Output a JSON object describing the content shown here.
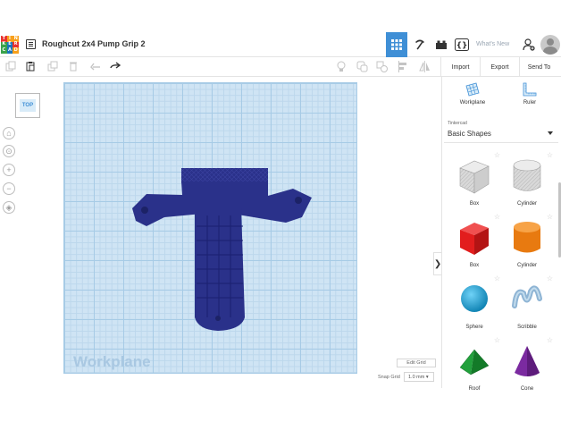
{
  "app": {
    "logo_letters": [
      "T",
      "I",
      "N",
      "K",
      "E",
      "R",
      "C",
      "A",
      "D"
    ],
    "logo_colors": [
      "#e8322f",
      "#f8a01c",
      "#f8a01c",
      "#3aa24a",
      "#1b75bb",
      "#e8322f",
      "#3aa24a",
      "#1b75bb",
      "#f8a01c"
    ],
    "design_title": "Roughcut 2x4 Pump Grip 2",
    "whats_new": "What's New"
  },
  "toolbar": {
    "import_label": "Import",
    "export_label": "Export",
    "send_to_label": "Send To"
  },
  "view": {
    "viewcube_face": "TOP"
  },
  "workplane": {
    "label": "Workplane",
    "edit_grid_label": "Edit Grid",
    "snap_grid_label": "Snap Grid",
    "snap_grid_value": "1.0 mm ▾"
  },
  "right_panel": {
    "workplane_tool": "Workplane",
    "ruler_tool": "Ruler",
    "library_owner": "Tinkercad",
    "library_name": "Basic Shapes",
    "shapes": [
      {
        "label": "Box",
        "icon": "box-hole-icon"
      },
      {
        "label": "Cylinder",
        "icon": "cylinder-hole-icon"
      },
      {
        "label": "Box",
        "icon": "box-red-icon"
      },
      {
        "label": "Cylinder",
        "icon": "cylinder-orange-icon"
      },
      {
        "label": "Sphere",
        "icon": "sphere-icon"
      },
      {
        "label": "Scribble",
        "icon": "scribble-icon"
      },
      {
        "label": "Roof",
        "icon": "roof-icon"
      },
      {
        "label": "Cone",
        "icon": "cone-icon"
      }
    ]
  },
  "colors": {
    "accent": "#3f8fd6",
    "model": "#2a318a",
    "grid_bg": "#cfe4f4"
  }
}
